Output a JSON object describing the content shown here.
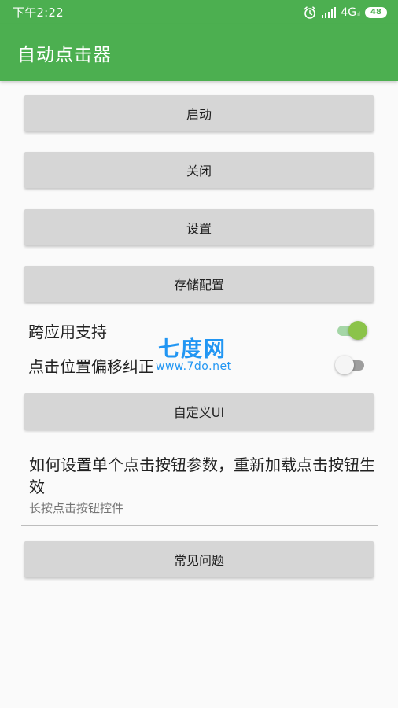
{
  "status_bar": {
    "time": "下午2:22",
    "network": "4G",
    "network_sub": "ıl",
    "battery": "48",
    "icons": [
      "alarm-icon",
      "signal-icon",
      "battery-icon"
    ]
  },
  "app_bar": {
    "title": "自动点击器"
  },
  "buttons": {
    "start": "启动",
    "close": "关闭",
    "settings": "设置",
    "save_config": "存储配置",
    "custom_ui": "自定义UI",
    "faq": "常见问题"
  },
  "switches": {
    "cross_app": {
      "label": "跨应用支持",
      "checked": true
    },
    "offset_correction": {
      "label": "点击位置偏移纠正",
      "checked": false
    }
  },
  "info": {
    "title": "如何设置单个点击按钮参数，重新加载点击按钮生效",
    "subtitle": "长按点击按钮控件"
  },
  "watermark": {
    "logo": "七度网",
    "url": "www.7do.net"
  },
  "colors": {
    "primary": "#4caf50",
    "switch_on": "#8bc34a",
    "button_bg": "#d6d6d6",
    "watermark": "#2196f3"
  }
}
